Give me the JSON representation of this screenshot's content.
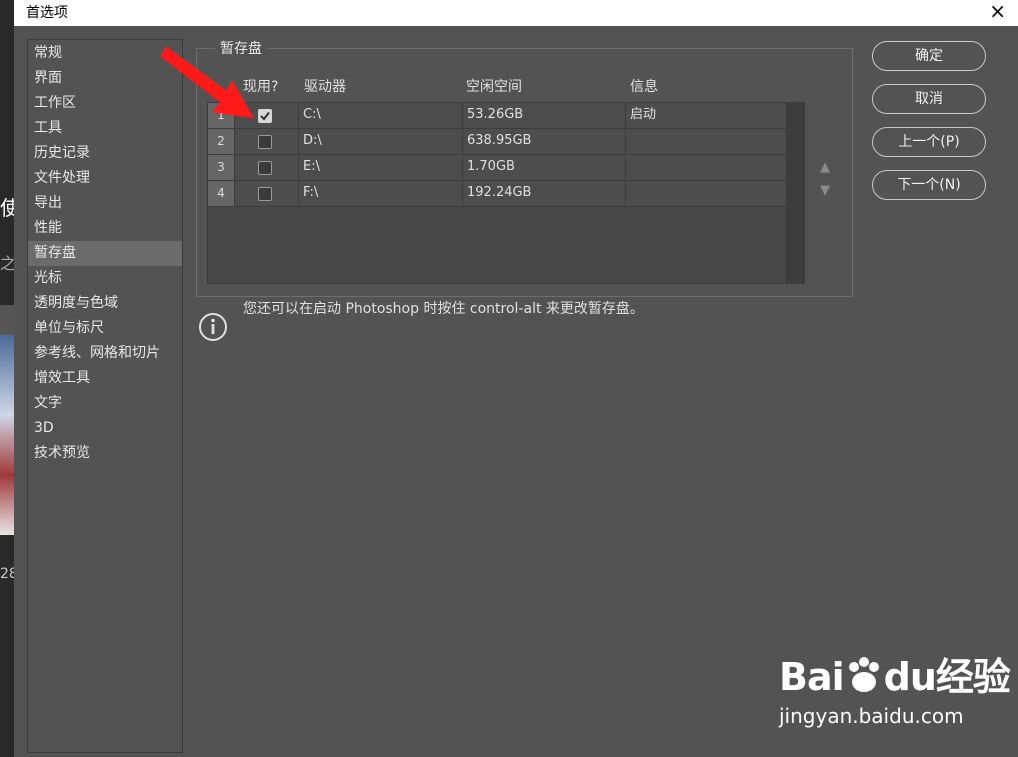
{
  "window": {
    "title": "首选项",
    "close_icon": "×"
  },
  "background_fragments": {
    "top": "使",
    "mid": "之",
    "bottom": "28"
  },
  "sidebar": {
    "items": [
      {
        "label": "常规"
      },
      {
        "label": "界面"
      },
      {
        "label": "工作区"
      },
      {
        "label": "工具"
      },
      {
        "label": "历史记录"
      },
      {
        "label": "文件处理"
      },
      {
        "label": "导出"
      },
      {
        "label": "性能"
      },
      {
        "label": "暂存盘"
      },
      {
        "label": "光标"
      },
      {
        "label": "透明度与色域"
      },
      {
        "label": "单位与标尺"
      },
      {
        "label": "参考线、网格和切片"
      },
      {
        "label": "增效工具"
      },
      {
        "label": "文字"
      },
      {
        "label": "3D"
      },
      {
        "label": "技术预览"
      }
    ],
    "active_index": 8
  },
  "scratch": {
    "group_label": "暂存盘",
    "columns": {
      "active": "现用?",
      "drive": "驱动器",
      "free": "空闲空间",
      "info": "信息"
    },
    "rows": [
      {
        "num": "1",
        "checked": true,
        "drive": "C:\\",
        "free": "53.26GB",
        "info": "启动"
      },
      {
        "num": "2",
        "checked": false,
        "drive": "D:\\",
        "free": "638.95GB",
        "info": ""
      },
      {
        "num": "3",
        "checked": false,
        "drive": "E:\\",
        "free": "1.70GB",
        "info": ""
      },
      {
        "num": "4",
        "checked": false,
        "drive": "F:\\",
        "free": "192.24GB",
        "info": ""
      }
    ],
    "move_up": "▲",
    "move_down": "▼"
  },
  "info_text": "您还可以在启动 Photoshop 时按住 control-alt 来更改暂存盘。",
  "buttons": {
    "ok": "确定",
    "cancel": "取消",
    "prev": "上一个(P)",
    "next": "下一个(N)"
  },
  "watermark": {
    "logo": "Bai",
    "logo_du": "du",
    "logo_cn": "经验",
    "url": "jingyan.baidu.com"
  },
  "colors": {
    "dialog_bg": "#535353",
    "active_item": "#6b6b6b",
    "arrow": "#ff1a1a"
  }
}
